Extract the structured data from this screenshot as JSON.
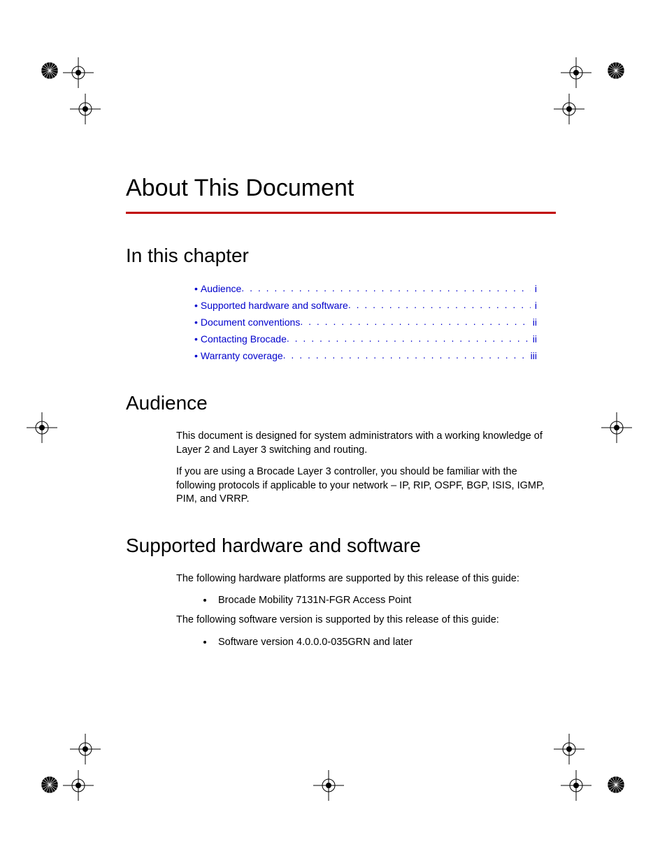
{
  "title": "About This Document",
  "sections": {
    "in_this_chapter": "In this chapter",
    "audience": "Audience",
    "supported_hw_sw": "Supported hardware and software"
  },
  "toc": [
    {
      "label": "Audience",
      "page": "i"
    },
    {
      "label": "Supported hardware and software",
      "page": "i"
    },
    {
      "label": "Document conventions",
      "page": "ii"
    },
    {
      "label": "Contacting Brocade",
      "page": "ii"
    },
    {
      "label": "Warranty coverage",
      "page": "iii"
    }
  ],
  "audience": {
    "p1": "This document is designed for system administrators with a working knowledge of Layer 2 and Layer 3 switching and routing.",
    "p2": "If you are using a Brocade Layer 3 controller, you should be familiar with the following protocols if applicable to your network – IP, RIP, OSPF, BGP, ISIS, IGMP, PIM, and VRRP."
  },
  "supported": {
    "intro_hw": "The following hardware platforms are supported by this release of this guide:",
    "hw_item": "Brocade Mobility 7131N-FGR Access Point",
    "intro_sw": "The following software version is supported by this release of this guide:",
    "sw_item": "Software version 4.0.0.0-035GRN and later"
  }
}
